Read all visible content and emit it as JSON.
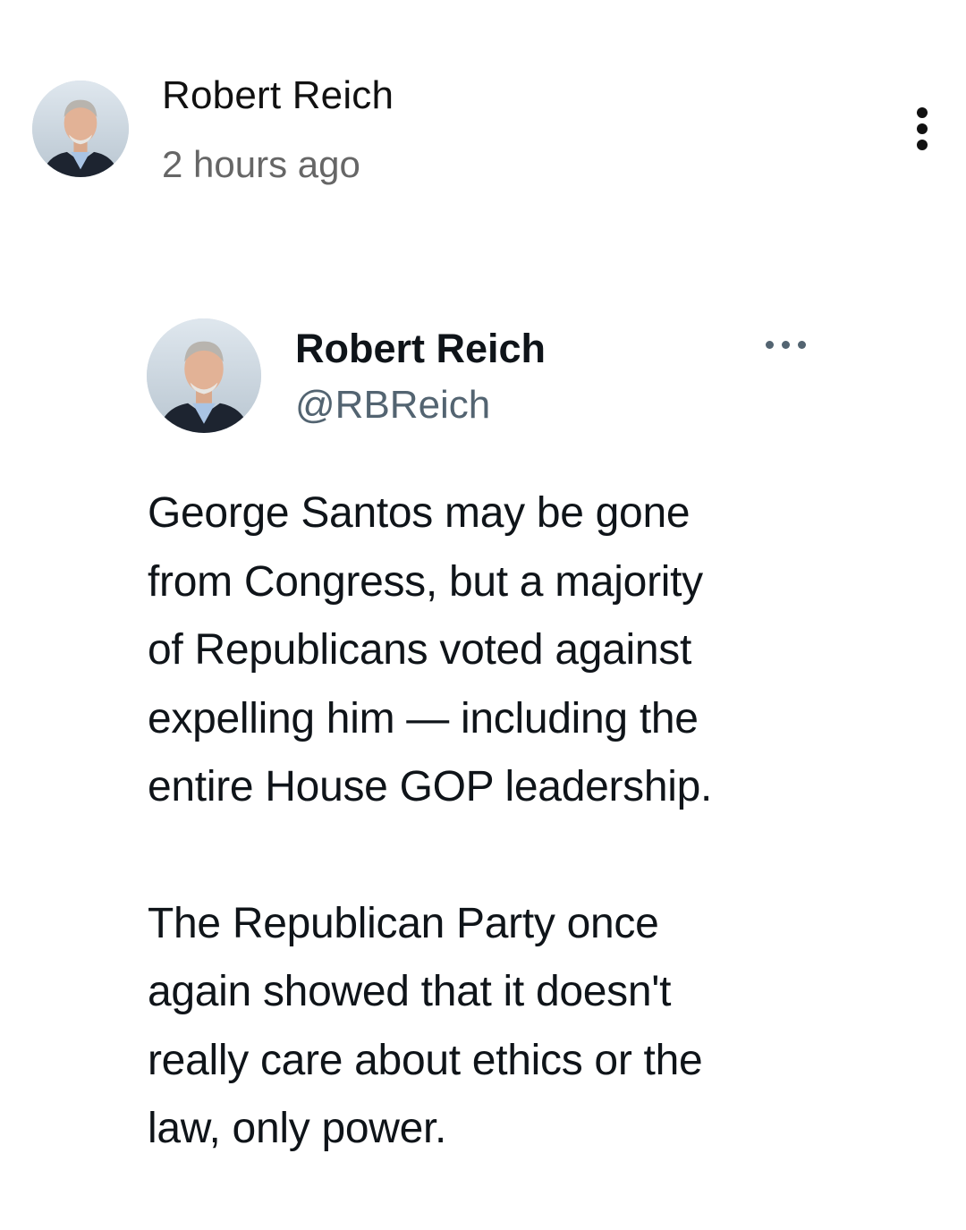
{
  "post": {
    "author_name": "Robert Reich",
    "timestamp": "2 hours ago",
    "avatar_icon": "user-avatar",
    "menu_icon": "more-vert-icon"
  },
  "tweet": {
    "display_name": "Robert Reich",
    "handle": "@RBReich",
    "avatar_icon": "user-avatar",
    "menu_icon": "more-horiz-icon",
    "paragraphs": [
      {
        "lines": [
          "George Santos may be gone",
          "from Congress, but a majority",
          "of Republicans voted against",
          "expelling him — including the",
          "entire House GOP leadership."
        ]
      },
      {
        "lines": [
          "The Republican Party once",
          "again showed that it doesn't",
          "really care about ethics or the",
          "law, only power."
        ]
      }
    ]
  },
  "colors": {
    "text_primary": "#0f1419",
    "text_secondary": "#536471",
    "timestamp": "#666666",
    "background": "#ffffff"
  }
}
